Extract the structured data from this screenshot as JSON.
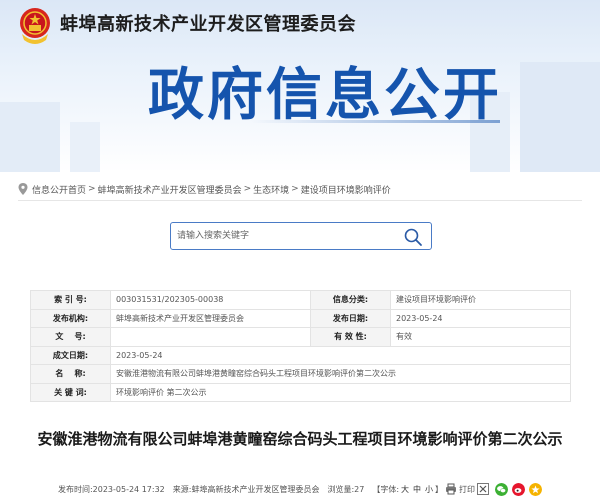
{
  "header": {
    "org_name": "蚌埠高新技术产业开发区管理委员会",
    "portal_title": "政府信息公开"
  },
  "breadcrumb": {
    "items": [
      "信息公开首页",
      "蚌埠高新技术产业开发区管理委员会",
      "生态环境",
      "建设项目环境影响评价"
    ],
    "separator": ">"
  },
  "search": {
    "placeholder": "请输入搜索关键字"
  },
  "info_table": {
    "index_label": "索 引 号:",
    "index_value": "003031531/202305-00038",
    "category_label": "信息分类:",
    "category_value": "建设项目环境影响评价",
    "publisher_label": "发布机构:",
    "publisher_value": "蚌埠高新技术产业开发区管理委员会",
    "publish_date_label": "发布日期:",
    "publish_date_value": "2023-05-24",
    "doc_no_label": "文    号:",
    "doc_no_value": "",
    "validity_label": "有 效 性:",
    "validity_value": "有效",
    "created_label": "成文日期:",
    "created_value": "2023-05-24",
    "name_label": "名    称:",
    "name_value": "安徽淮港物流有限公司蚌埠港黄疃窑综合码头工程项目环境影响评价第二次公示",
    "keywords_label": "关 键 词:",
    "keywords_value": "环境影响评价 第二次公示"
  },
  "article": {
    "title": "安徽淮港物流有限公司蚌埠港黄疃窑综合码头工程项目环境影响评价第二次公示",
    "published_label": "发布时间:",
    "published_value": "2023-05-24 17:32",
    "source_label": "来源:",
    "source_value": "蚌埠高新技术产业开发区管理委员会",
    "views_label": "浏览量:",
    "views_value": "27",
    "font_label": "【字体:",
    "font_large": "大",
    "font_medium": "中",
    "font_small": "小",
    "font_close": "】",
    "print_label": "打印"
  },
  "colors": {
    "primary_blue": "#1554ad",
    "wechat": "#3cb034",
    "weibo": "#e6162d",
    "qzone": "#f5b300"
  }
}
